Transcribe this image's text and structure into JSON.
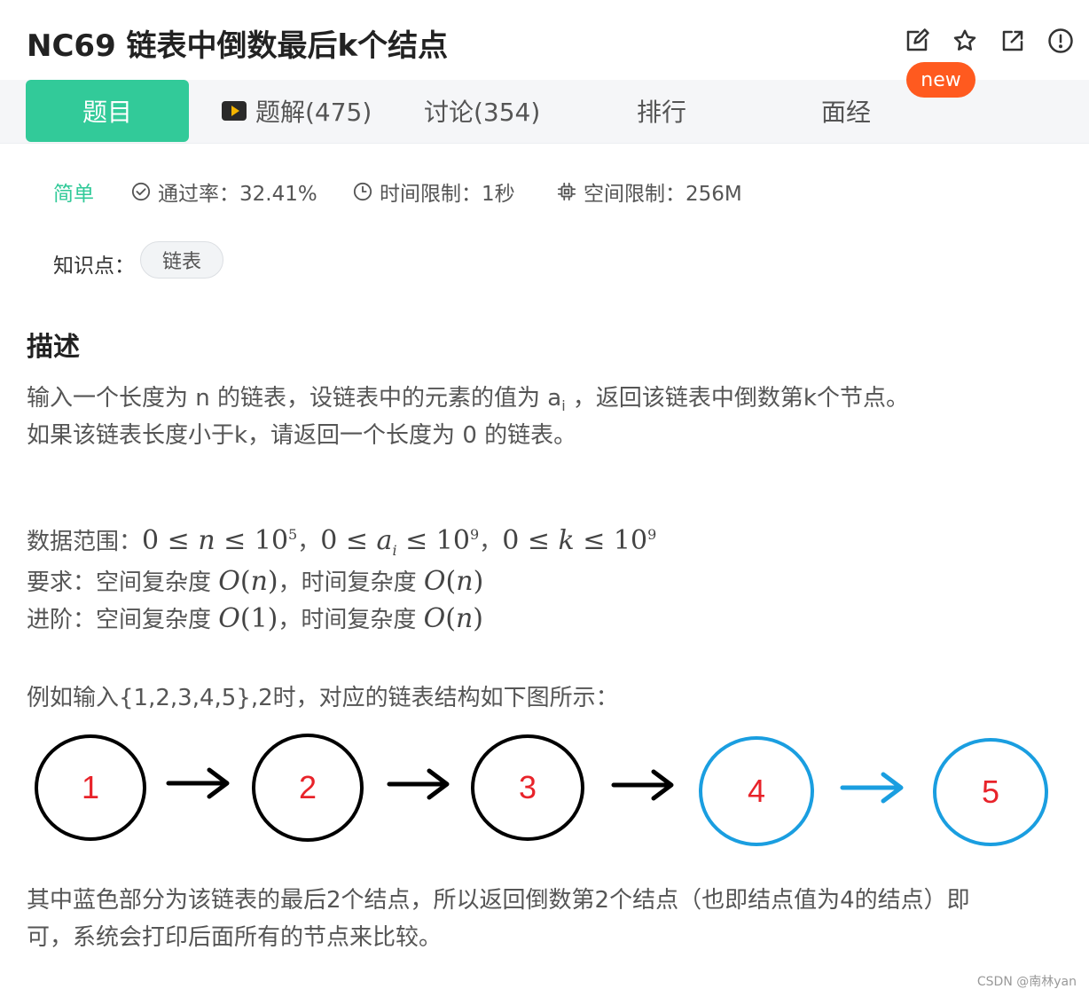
{
  "header": {
    "title": "NC69  链表中倒数最后k个结点",
    "icons": [
      "edit-icon",
      "star-icon",
      "share-icon",
      "report-icon"
    ]
  },
  "tabs": [
    {
      "label": "题目",
      "active": true
    },
    {
      "label": "题解(475)",
      "icon": "video-icon"
    },
    {
      "label": "讨论(354)"
    },
    {
      "label": "排行"
    },
    {
      "label": "面经"
    }
  ],
  "new_badge": "new",
  "meta": {
    "difficulty": "简单",
    "pass_rate": "通过率：32.41%",
    "time_limit": "时间限制：1秒",
    "space_limit": "空间限制：256M"
  },
  "knowledge": {
    "label": "知识点：",
    "tag": "链表"
  },
  "description": {
    "heading": "描述",
    "line1_a": "输入一个长度为 n 的链表，设链表中的元素的值为 a",
    "line1_sub": "i",
    "line1_b": " ，返回该链表中倒数第k个节点。",
    "line2": "如果该链表长度小于k，请返回一个长度为 0 的链表。",
    "range_label": "数据范围：",
    "req_label": "要求：空间复杂度 ",
    "req_mid": "，时间复杂度 ",
    "adv_label": "进阶：空间复杂度 ",
    "adv_mid": "，时间复杂度 ",
    "example": "例如输入{1,2,3,4,5},2时，对应的链表结构如下图所示：",
    "explain_line1": "其中蓝色部分为该链表的最后2个结点，所以返回倒数第2个结点（也即结点值为4的结点）即",
    "explain_line2": "可，系统会打印后面所有的节点来比较。"
  },
  "diagram": {
    "nodes": [
      {
        "value": "1",
        "highlight": false
      },
      {
        "value": "2",
        "highlight": false
      },
      {
        "value": "3",
        "highlight": false
      },
      {
        "value": "4",
        "highlight": true
      },
      {
        "value": "5",
        "highlight": true
      }
    ],
    "colors": {
      "normal": "#000000",
      "highlight": "#1a9ee0",
      "text": "#e8232a"
    }
  },
  "watermark": "CSDN @南林yan"
}
